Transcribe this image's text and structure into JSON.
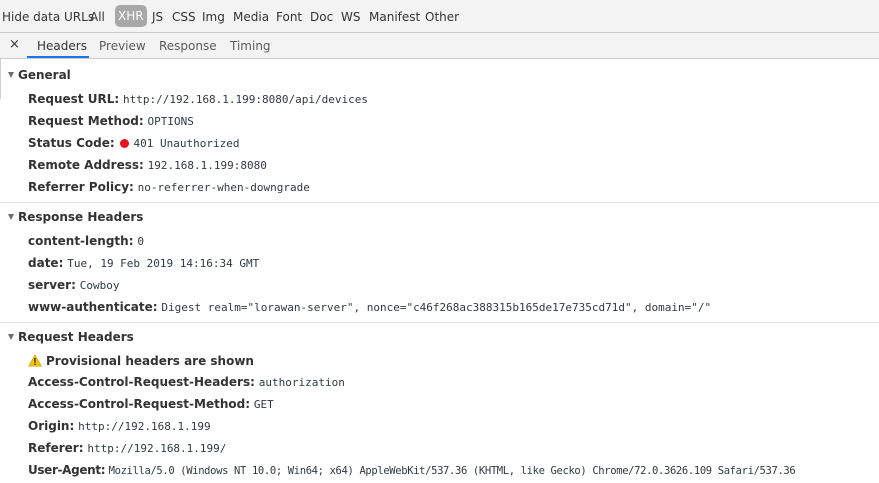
{
  "filter_bar": {
    "hide_data_urls_label": "Hide data URLs",
    "filters": [
      {
        "label": "All",
        "active": false
      },
      {
        "label": "XHR",
        "active": true
      },
      {
        "label": "JS",
        "active": false
      },
      {
        "label": "CSS",
        "active": false
      },
      {
        "label": "Img",
        "active": false
      },
      {
        "label": "Media",
        "active": false
      },
      {
        "label": "Font",
        "active": false
      },
      {
        "label": "Doc",
        "active": false
      },
      {
        "label": "WS",
        "active": false
      },
      {
        "label": "Manifest",
        "active": false
      },
      {
        "label": "Other",
        "active": false
      }
    ]
  },
  "tab_bar": {
    "close_label": "×",
    "tabs": [
      {
        "label": "Headers",
        "active": true
      },
      {
        "label": "Preview",
        "active": false
      },
      {
        "label": "Response",
        "active": false
      },
      {
        "label": "Timing",
        "active": false
      }
    ]
  },
  "general": {
    "title": "General",
    "rows": [
      {
        "key": "Request URL:",
        "value": "http://192.168.1.199:8080/api/devices"
      },
      {
        "key": "Request Method:",
        "value": "OPTIONS"
      },
      {
        "key": "Status Code:",
        "value": "401 Unauthorized"
      },
      {
        "key": "Remote Address:",
        "value": "192.168.1.199:8080"
      },
      {
        "key": "Referrer Policy:",
        "value": "no-referrer-when-downgrade"
      }
    ]
  },
  "response_headers": {
    "title": "Response Headers",
    "rows": [
      {
        "key": "content-length:",
        "value": "0"
      },
      {
        "key": "date:",
        "value": "Tue, 19 Feb 2019 14:16:34 GMT"
      },
      {
        "key": "server:",
        "value": "Cowboy"
      },
      {
        "key": "www-authenticate:",
        "value": "Digest realm=\"lorawan-server\", nonce=\"c46f268ac388315b165de17e735cd71d\", domain=\"/\""
      }
    ]
  },
  "request_headers": {
    "title": "Request Headers",
    "warning": "Provisional headers are shown",
    "rows": [
      {
        "key": "Access-Control-Request-Headers:",
        "value": "authorization"
      },
      {
        "key": "Access-Control-Request-Method:",
        "value": "GET"
      },
      {
        "key": "Origin:",
        "value": "http://192.168.1.199"
      },
      {
        "key": "Referer:",
        "value": "http://192.168.1.199/"
      },
      {
        "key": "User-Agent:",
        "value": "Mozilla/5.0 (Windows NT 10.0; Win64; x64) AppleWebKit/537.36 (KHTML, like Gecko) Chrome/72.0.3626.109 Safari/537.36"
      }
    ]
  },
  "colors": {
    "status_error": "#e8141b",
    "tab_underline": "#1a73e8",
    "warning": "#f2c500"
  },
  "icons": {
    "status": "red-circle-icon",
    "warning": "warning-triangle-icon",
    "expand": "triangle-down-icon",
    "close": "close-icon"
  }
}
